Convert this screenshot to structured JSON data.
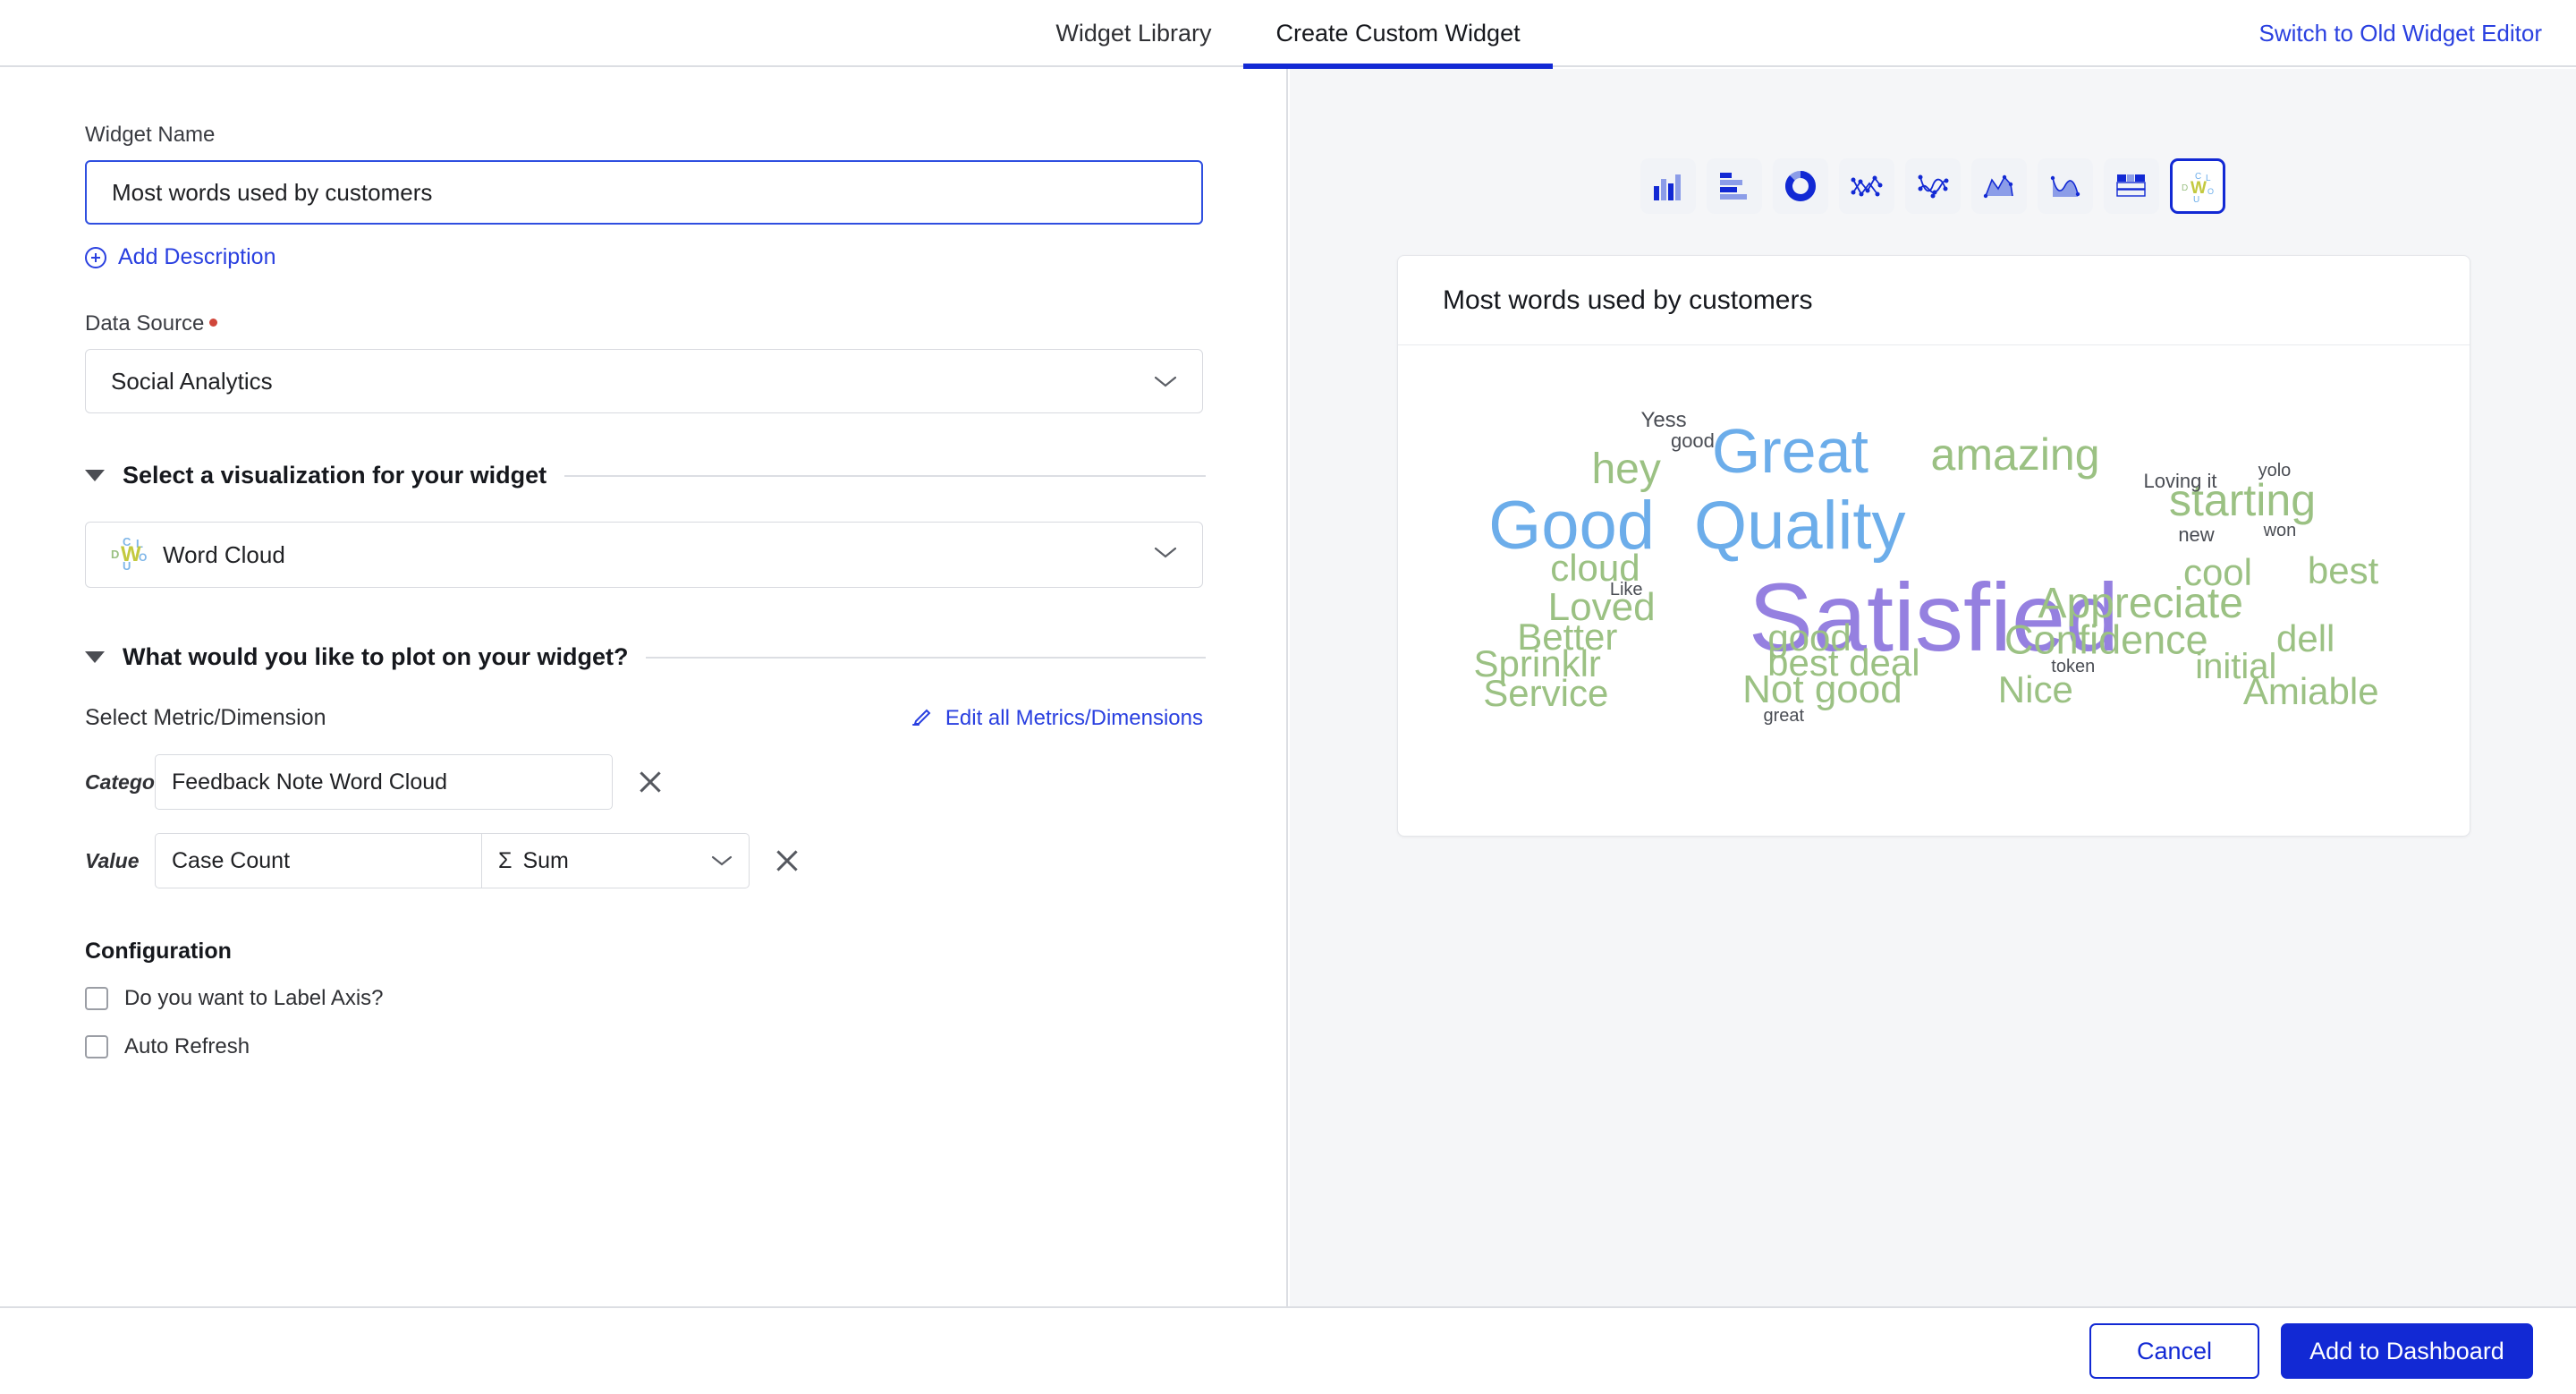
{
  "header": {
    "tabs": [
      {
        "label": "Widget Library",
        "active": false
      },
      {
        "label": "Create Custom Widget",
        "active": true
      }
    ],
    "switch_link": "Switch to Old Widget Editor"
  },
  "form": {
    "widget_name_label": "Widget Name",
    "widget_name_value": "Most words used by customers",
    "add_description": "Add Description",
    "data_source_label": "Data Source",
    "data_source_value": "Social Analytics",
    "viz_section_title": "Select a visualization for your widget",
    "viz_selected": "Word Cloud",
    "plot_section_title": "What would you like to plot on your widget?",
    "metric_dimension_label": "Select Metric/Dimension",
    "edit_all_link": "Edit all Metrics/Dimensions",
    "category_label": "Category",
    "category_value": "Feedback Note Word Cloud",
    "value_label": "Value",
    "value_value": "Case Count",
    "aggregation_value": "Sum",
    "aggregation_symbol": "Σ",
    "configuration_title": "Configuration",
    "checkboxes": [
      {
        "label": "Do you want to Label Axis?",
        "checked": false
      },
      {
        "label": "Auto Refresh",
        "checked": false
      }
    ]
  },
  "chart_types": [
    {
      "name": "column-chart-icon",
      "selected": false
    },
    {
      "name": "bar-chart-icon",
      "selected": false
    },
    {
      "name": "donut-chart-icon",
      "selected": false
    },
    {
      "name": "scatter-line-chart-icon",
      "selected": false
    },
    {
      "name": "spline-chart-icon",
      "selected": false
    },
    {
      "name": "area-chart-icon",
      "selected": false
    },
    {
      "name": "spline-area-chart-icon",
      "selected": false
    },
    {
      "name": "table-icon",
      "selected": false
    },
    {
      "name": "word-cloud-icon",
      "selected": true
    }
  ],
  "preview": {
    "title": "Most words used by customers"
  },
  "footer": {
    "cancel_label": "Cancel",
    "primary_label": "Add to Dashboard"
  },
  "colors": {
    "accent_blue": "#1229d4",
    "link_blue": "#2a40e0",
    "wc_blue": "#6cadea",
    "wc_green": "#9bc183",
    "wc_purple": "#9580e0",
    "wc_gray": "#4a4d54",
    "required_red": "#d0463a"
  },
  "chart_data": {
    "type": "wordcloud",
    "title": "Most words used by customers",
    "category_field": "Feedback Note Word Cloud",
    "value_field": "Case Count",
    "aggregation": "Sum",
    "words": [
      {
        "text": "Satisfied",
        "size": 108,
        "color": "#9580e0",
        "x": 50.0,
        "y": 55.5
      },
      {
        "text": "Good",
        "size": 76,
        "color": "#6cadea",
        "x": 16.2,
        "y": 36.8
      },
      {
        "text": "Quality",
        "size": 76,
        "color": "#6cadea",
        "x": 37.5,
        "y": 36.8
      },
      {
        "text": "Great",
        "size": 70,
        "color": "#6cadea",
        "x": 36.6,
        "y": 21.5
      },
      {
        "text": "amazing",
        "size": 50,
        "color": "#9bc183",
        "x": 57.6,
        "y": 22.2
      },
      {
        "text": "hey",
        "size": 48,
        "color": "#9bc183",
        "x": 21.3,
        "y": 25.3
      },
      {
        "text": "starting",
        "size": 50,
        "color": "#9bc183",
        "x": 78.8,
        "y": 31.5
      },
      {
        "text": "Appreciate",
        "size": 48,
        "color": "#9bc183",
        "x": 69.3,
        "y": 52.7
      },
      {
        "text": "Confidence",
        "size": 45,
        "color": "#9bc183",
        "x": 66.1,
        "y": 60.0
      },
      {
        "text": "cloud",
        "size": 42,
        "color": "#9bc183",
        "x": 18.4,
        "y": 45.5
      },
      {
        "text": "Loved",
        "size": 44,
        "color": "#9bc183",
        "x": 19.0,
        "y": 53.5
      },
      {
        "text": "Better",
        "size": 42,
        "color": "#9bc183",
        "x": 15.8,
        "y": 59.4
      },
      {
        "text": "good",
        "size": 42,
        "color": "#9bc183",
        "x": 38.4,
        "y": 59.6
      },
      {
        "text": "Sprinklr",
        "size": 42,
        "color": "#9bc183",
        "x": 13.0,
        "y": 64.9
      },
      {
        "text": "best deal",
        "size": 42,
        "color": "#9bc183",
        "x": 41.6,
        "y": 64.8
      },
      {
        "text": "Not good",
        "size": 44,
        "color": "#9bc183",
        "x": 39.6,
        "y": 70.3
      },
      {
        "text": "Service",
        "size": 42,
        "color": "#9bc183",
        "x": 13.8,
        "y": 71.0
      },
      {
        "text": "Nice",
        "size": 42,
        "color": "#9bc183",
        "x": 59.5,
        "y": 70.2
      },
      {
        "text": "cool",
        "size": 42,
        "color": "#9bc183",
        "x": 76.5,
        "y": 46.3
      },
      {
        "text": "best",
        "size": 42,
        "color": "#9bc183",
        "x": 88.2,
        "y": 46.0
      },
      {
        "text": "dell",
        "size": 42,
        "color": "#9bc183",
        "x": 84.7,
        "y": 59.8
      },
      {
        "text": "initial",
        "size": 40,
        "color": "#9bc183",
        "x": 78.2,
        "y": 65.5
      },
      {
        "text": "Amiable",
        "size": 42,
        "color": "#9bc183",
        "x": 85.2,
        "y": 70.7
      },
      {
        "text": "Yess",
        "size": 24,
        "color": "#4a4d54",
        "x": 24.8,
        "y": 15.3
      },
      {
        "text": "good",
        "size": 22,
        "color": "#4a4d54",
        "x": 27.5,
        "y": 19.5
      },
      {
        "text": "Loving it",
        "size": 22,
        "color": "#4a4d54",
        "x": 73.0,
        "y": 27.8
      },
      {
        "text": "yolo",
        "size": 20,
        "color": "#4a4d54",
        "x": 81.8,
        "y": 25.6
      },
      {
        "text": "new",
        "size": 22,
        "color": "#4a4d54",
        "x": 74.5,
        "y": 38.7
      },
      {
        "text": "won",
        "size": 20,
        "color": "#4a4d54",
        "x": 82.3,
        "y": 37.8
      },
      {
        "text": "Like",
        "size": 20,
        "color": "#4a4d54",
        "x": 21.3,
        "y": 49.8
      },
      {
        "text": "token",
        "size": 20,
        "color": "#4a4d54",
        "x": 63.0,
        "y": 65.6
      },
      {
        "text": "great",
        "size": 20,
        "color": "#4a4d54",
        "x": 36.0,
        "y": 75.6
      }
    ]
  }
}
